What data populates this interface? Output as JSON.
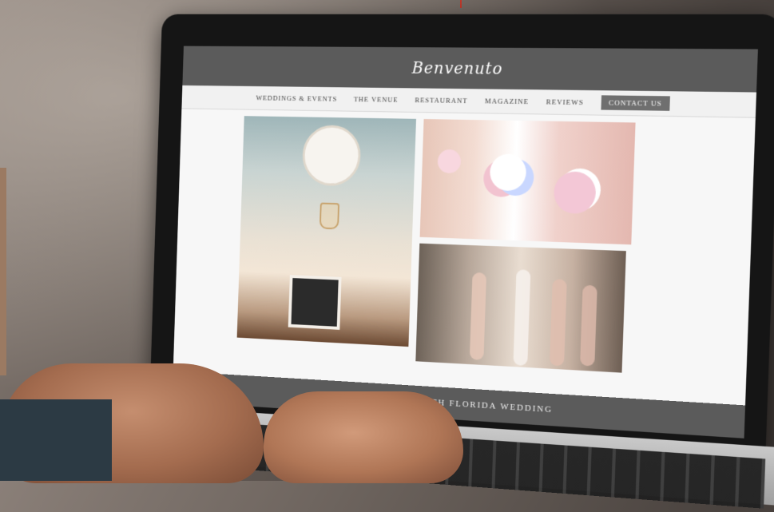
{
  "site": {
    "logo": "Benvenuto",
    "nav": [
      {
        "label": "WEDDINGS & EVENTS"
      },
      {
        "label": "THE VENUE"
      },
      {
        "label": "RESTAURANT"
      },
      {
        "label": "MAGAZINE"
      },
      {
        "label": "REVIEWS"
      },
      {
        "label": "CONTACT US"
      }
    ],
    "tagline": "A DAZZLING SOUTH FLORIDA WEDDING"
  },
  "colors": {
    "header_bg": "#5b5b5b",
    "nav_bg": "#f1f1f1",
    "cta_bg": "#6f6f6f",
    "accent": "#c0392b"
  },
  "icons": [
    "ceiling-medallion",
    "chandelier",
    "doorway",
    "bouquet-flowers"
  ]
}
